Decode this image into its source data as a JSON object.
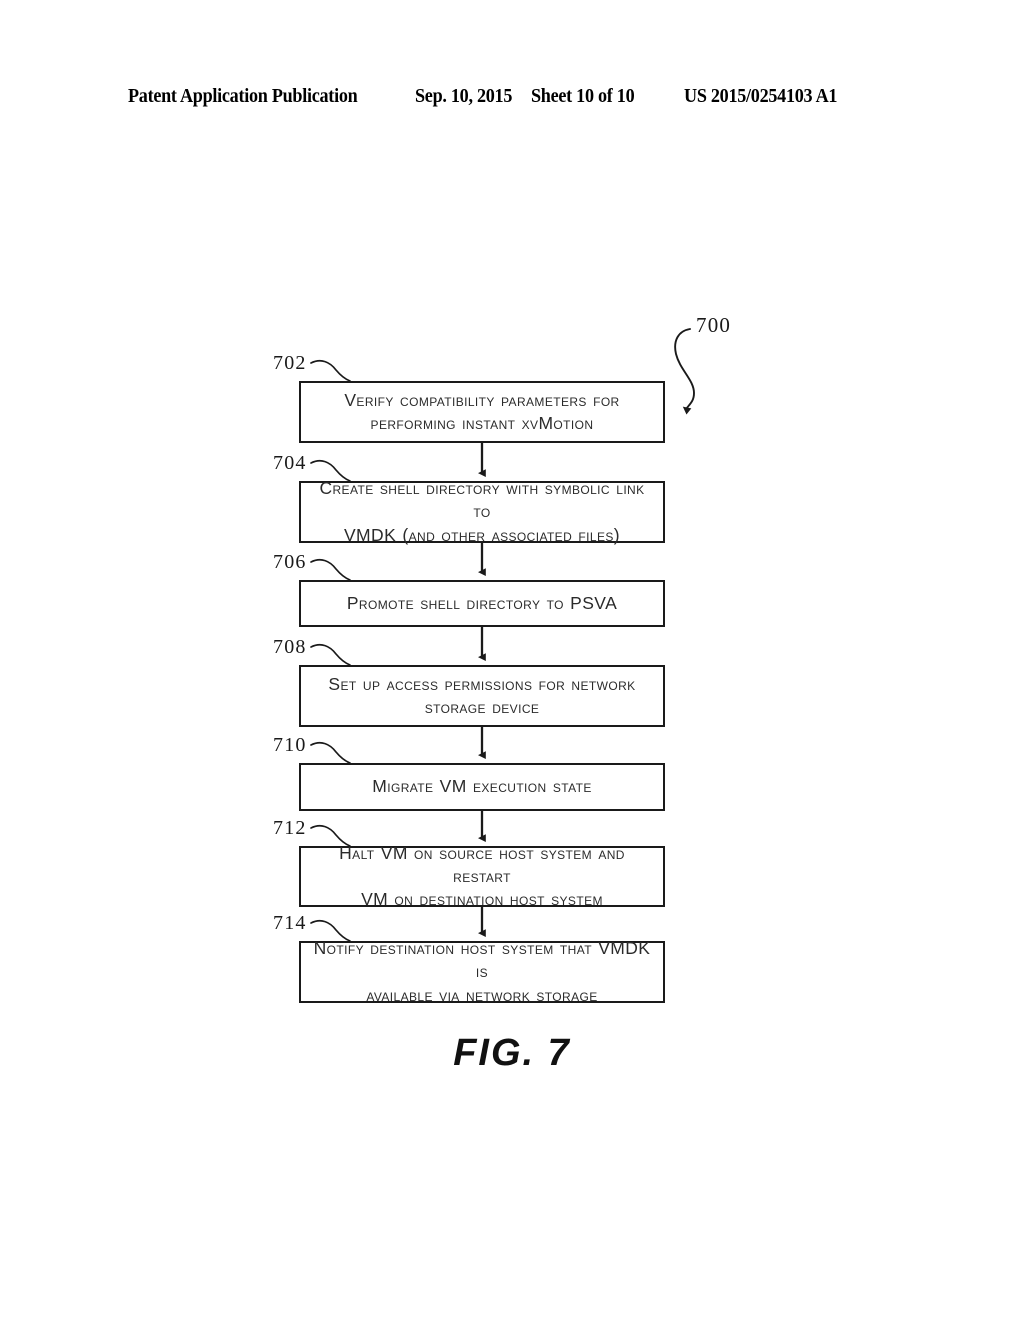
{
  "header": {
    "publication": "Patent Application Publication",
    "date": "Sep. 10, 2015",
    "sheet": "Sheet 10 of 10",
    "patent_number": "US 2015/0254103 A1"
  },
  "figure": {
    "caption": "FIG. 7",
    "diagram_ref": "700",
    "type": "flowchart",
    "nodes": [
      {
        "ref": "702",
        "text": "Verify compatibility parameters for\nperforming instant xvMotion"
      },
      {
        "ref": "704",
        "text": "Create shell directory with symbolic link to\nVMDK (and other associated files)"
      },
      {
        "ref": "706",
        "text": "Promote shell directory to PSVA"
      },
      {
        "ref": "708",
        "text": "Set up access permissions for network\nstorage device"
      },
      {
        "ref": "710",
        "text": "Migrate VM execution state"
      },
      {
        "ref": "712",
        "text": "Halt VM on source host system and restart\nVM on destination host system"
      },
      {
        "ref": "714",
        "text": "Notify destination host system that VMDK is\navailable via network storage"
      }
    ],
    "connectors": [
      {
        "from": "702",
        "to": "704"
      },
      {
        "from": "704",
        "to": "706"
      },
      {
        "from": "706",
        "to": "708"
      },
      {
        "from": "708",
        "to": "710"
      },
      {
        "from": "710",
        "to": "712"
      },
      {
        "from": "712",
        "to": "714"
      }
    ],
    "colors": {
      "ink": "#1a1a1a",
      "text": "#2b2b2b",
      "background": "#ffffff"
    }
  }
}
